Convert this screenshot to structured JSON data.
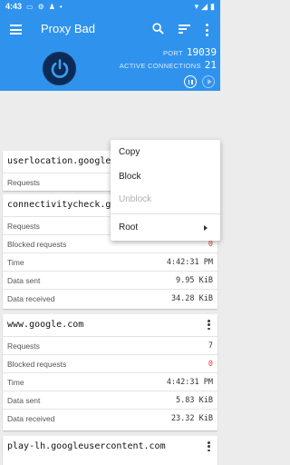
{
  "status_bar": {
    "time": "4:43"
  },
  "app_bar": {
    "title": "Proxy Bad"
  },
  "stats": {
    "port_label": "PORT",
    "port_value": "19039",
    "active_connections_label": "ACTIVE CONNECTIONS",
    "active_connections_value": "21"
  },
  "colors": {
    "app_bar": "#2f93ee",
    "blocked_count": "#e53935"
  },
  "cards": [
    {
      "host": "userlocation.googleapis.com",
      "rows": [
        {
          "label": "Requests",
          "value": ""
        }
      ]
    },
    {
      "host": "connectivitycheck.gstatic.com",
      "rows": [
        {
          "label": "Requests",
          "value": ""
        },
        {
          "label": "Blocked requests",
          "value": "0"
        },
        {
          "label": "Time",
          "value": "4:42:31 PM"
        },
        {
          "label": "Data sent",
          "value": "9.95 KiB"
        },
        {
          "label": "Data received",
          "value": "34.28 KiB"
        }
      ]
    },
    {
      "host": "www.google.com",
      "rows": [
        {
          "label": "Requests",
          "value": "7"
        },
        {
          "label": "Blocked requests",
          "value": "0"
        },
        {
          "label": "Time",
          "value": "4:42:31 PM"
        },
        {
          "label": "Data sent",
          "value": "5.83 KiB"
        },
        {
          "label": "Data received",
          "value": "23.32 KiB"
        }
      ]
    },
    {
      "host": "play-lh.googleusercontent.com",
      "rows": []
    }
  ],
  "popup_menu": {
    "copy": "Copy",
    "block": "Block",
    "unblock": "Unblock",
    "root": "Root"
  }
}
